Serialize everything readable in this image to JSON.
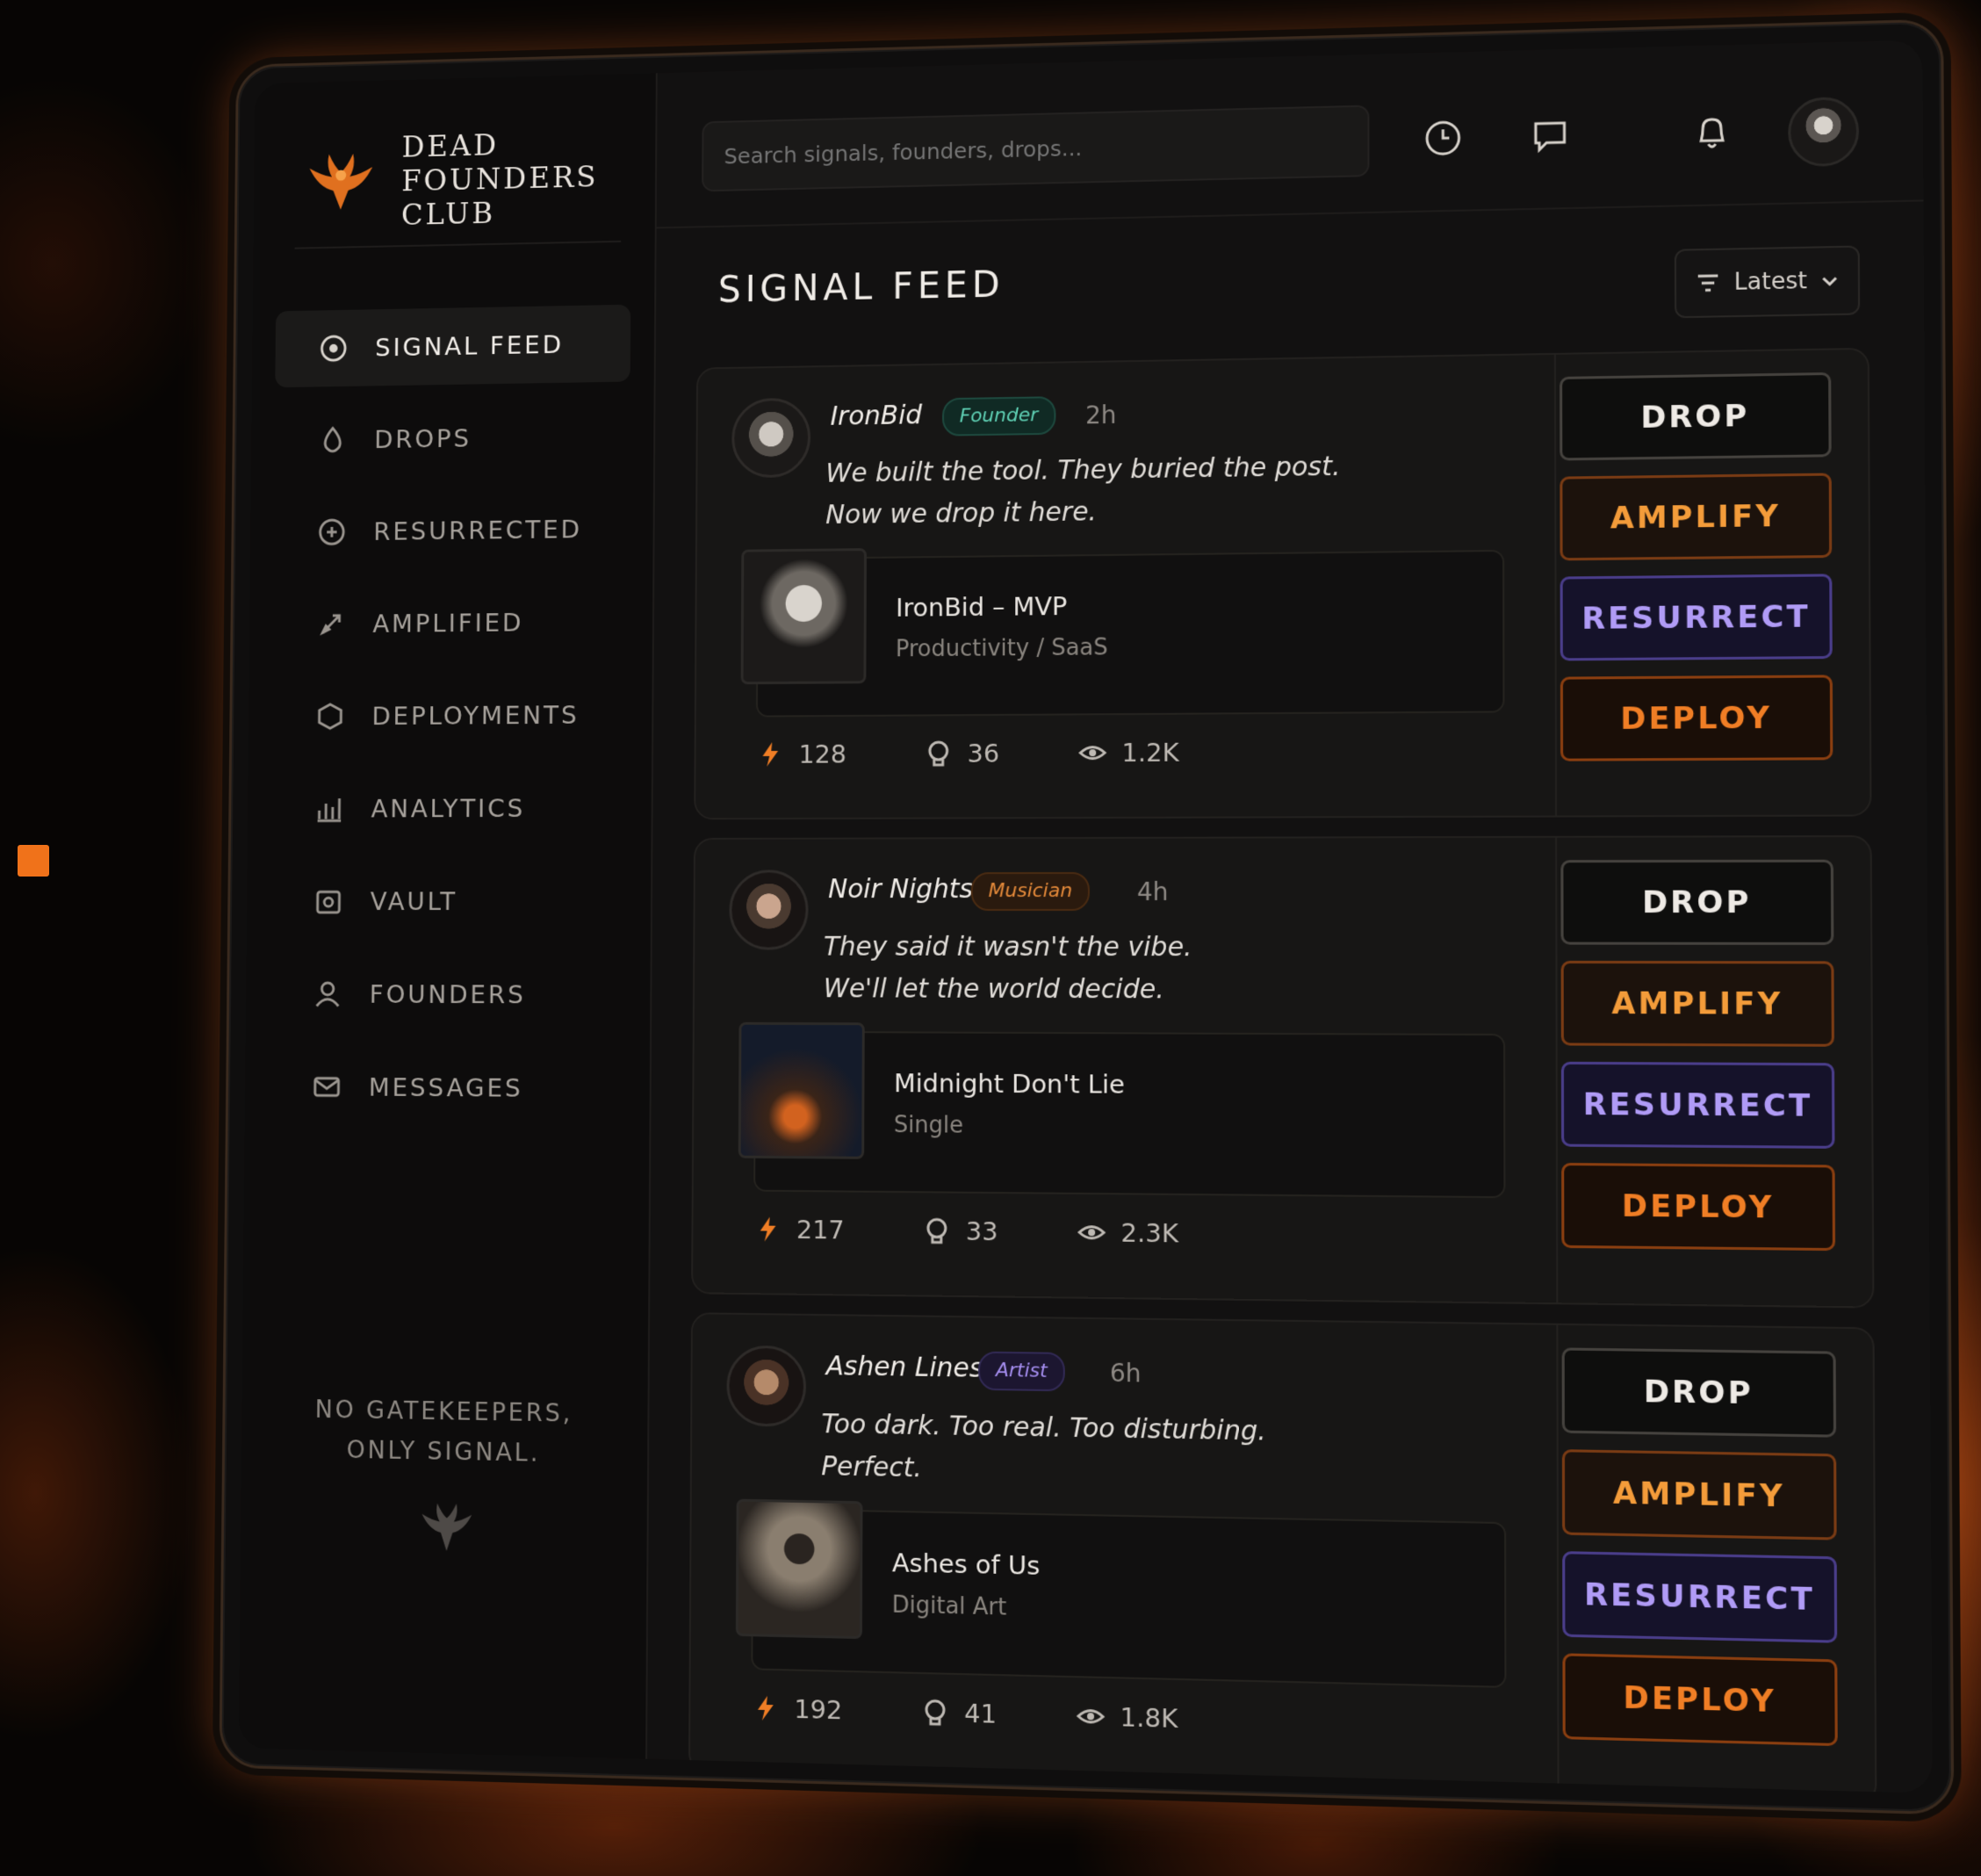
{
  "app": {
    "brand_name": "DEAD FOUNDERS CLUB",
    "tagline_line1": "NO GATEKEEPERS,",
    "tagline_line2": "ONLY SIGNAL."
  },
  "sidebar": {
    "items": [
      {
        "label": "SIGNAL FEED",
        "icon": "signal-icon",
        "active": true
      },
      {
        "label": "DROPS",
        "icon": "drop-icon"
      },
      {
        "label": "RESURRECTED",
        "icon": "resurrect-icon"
      },
      {
        "label": "AMPLIFIED",
        "icon": "rocket-icon"
      },
      {
        "label": "DEPLOYMENTS",
        "icon": "deploy-icon"
      },
      {
        "label": "ANALYTICS",
        "icon": "chart-icon"
      },
      {
        "label": "VAULT",
        "icon": "vault-icon"
      },
      {
        "label": "FOUNDERS",
        "icon": "user-icon"
      },
      {
        "label": "MESSAGES",
        "icon": "mail-icon"
      }
    ]
  },
  "topbar": {
    "search_placeholder": "Search signals, founders, drops...",
    "icons": [
      "clock-icon",
      "chat-icon",
      "bell-icon",
      "profile-avatar"
    ]
  },
  "feed": {
    "title": "SIGNAL FEED",
    "sort_label": "Latest",
    "posts": [
      {
        "author": "IronBid",
        "role": "Founder",
        "time": "2h",
        "message_line1": "We built the tool. They buried the post.",
        "message_line2": "Now we drop it here.",
        "attachment_title": "IronBid – MVP",
        "attachment_sub": "Productivity / SaaS",
        "bolts": "128",
        "skulls": "36",
        "views": "1.2K",
        "role_color": "#5fd0b4"
      },
      {
        "author": "Noir Nights",
        "role": "Musician",
        "time": "4h",
        "message_line1": "They said it wasn't the vibe.",
        "message_line2": "We'll let the world decide.",
        "attachment_title": "Midnight Don't Lie",
        "attachment_sub": "Single",
        "bolts": "217",
        "skulls": "33",
        "views": "2.3K",
        "role_color": "#e58a3a"
      },
      {
        "author": "Ashen Lines",
        "role": "Artist",
        "time": "6h",
        "message_line1": "Too dark. Too real. Too disturbing.",
        "message_line2": "Perfect.",
        "attachment_title": "Ashes of Us",
        "attachment_sub": "Digital Art",
        "bolts": "192",
        "skulls": "41",
        "views": "1.8K",
        "role_color": "#a58ef0"
      }
    ],
    "actions": {
      "drop": "DROP",
      "amplify": "AMPLIFY",
      "resurrect": "RESURRECT",
      "deploy": "DEPLOY"
    }
  },
  "colors": {
    "accent_orange": "#f07e25",
    "accent_purple": "#b09bf6",
    "background": "#121111"
  }
}
